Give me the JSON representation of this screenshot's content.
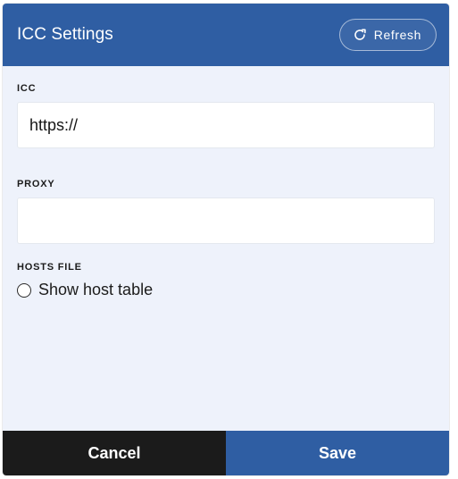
{
  "dialog": {
    "title": "ICC Settings",
    "refresh_label": "Refresh",
    "refresh_icon": "refresh-icon"
  },
  "fields": {
    "icc": {
      "label": "ICC",
      "value": "https://",
      "placeholder": ""
    },
    "proxy": {
      "label": "PROXY",
      "value": "",
      "placeholder": ""
    },
    "hosts_file": {
      "label": "HOSTS FILE",
      "option_label": "Show host table",
      "checked": false
    }
  },
  "footer": {
    "cancel_label": "Cancel",
    "save_label": "Save"
  },
  "colors": {
    "header_bg": "#2f5ea3",
    "panel_bg": "#eef2fb",
    "cancel_bg": "#1b1b1b",
    "save_bg": "#2f5ea3"
  }
}
